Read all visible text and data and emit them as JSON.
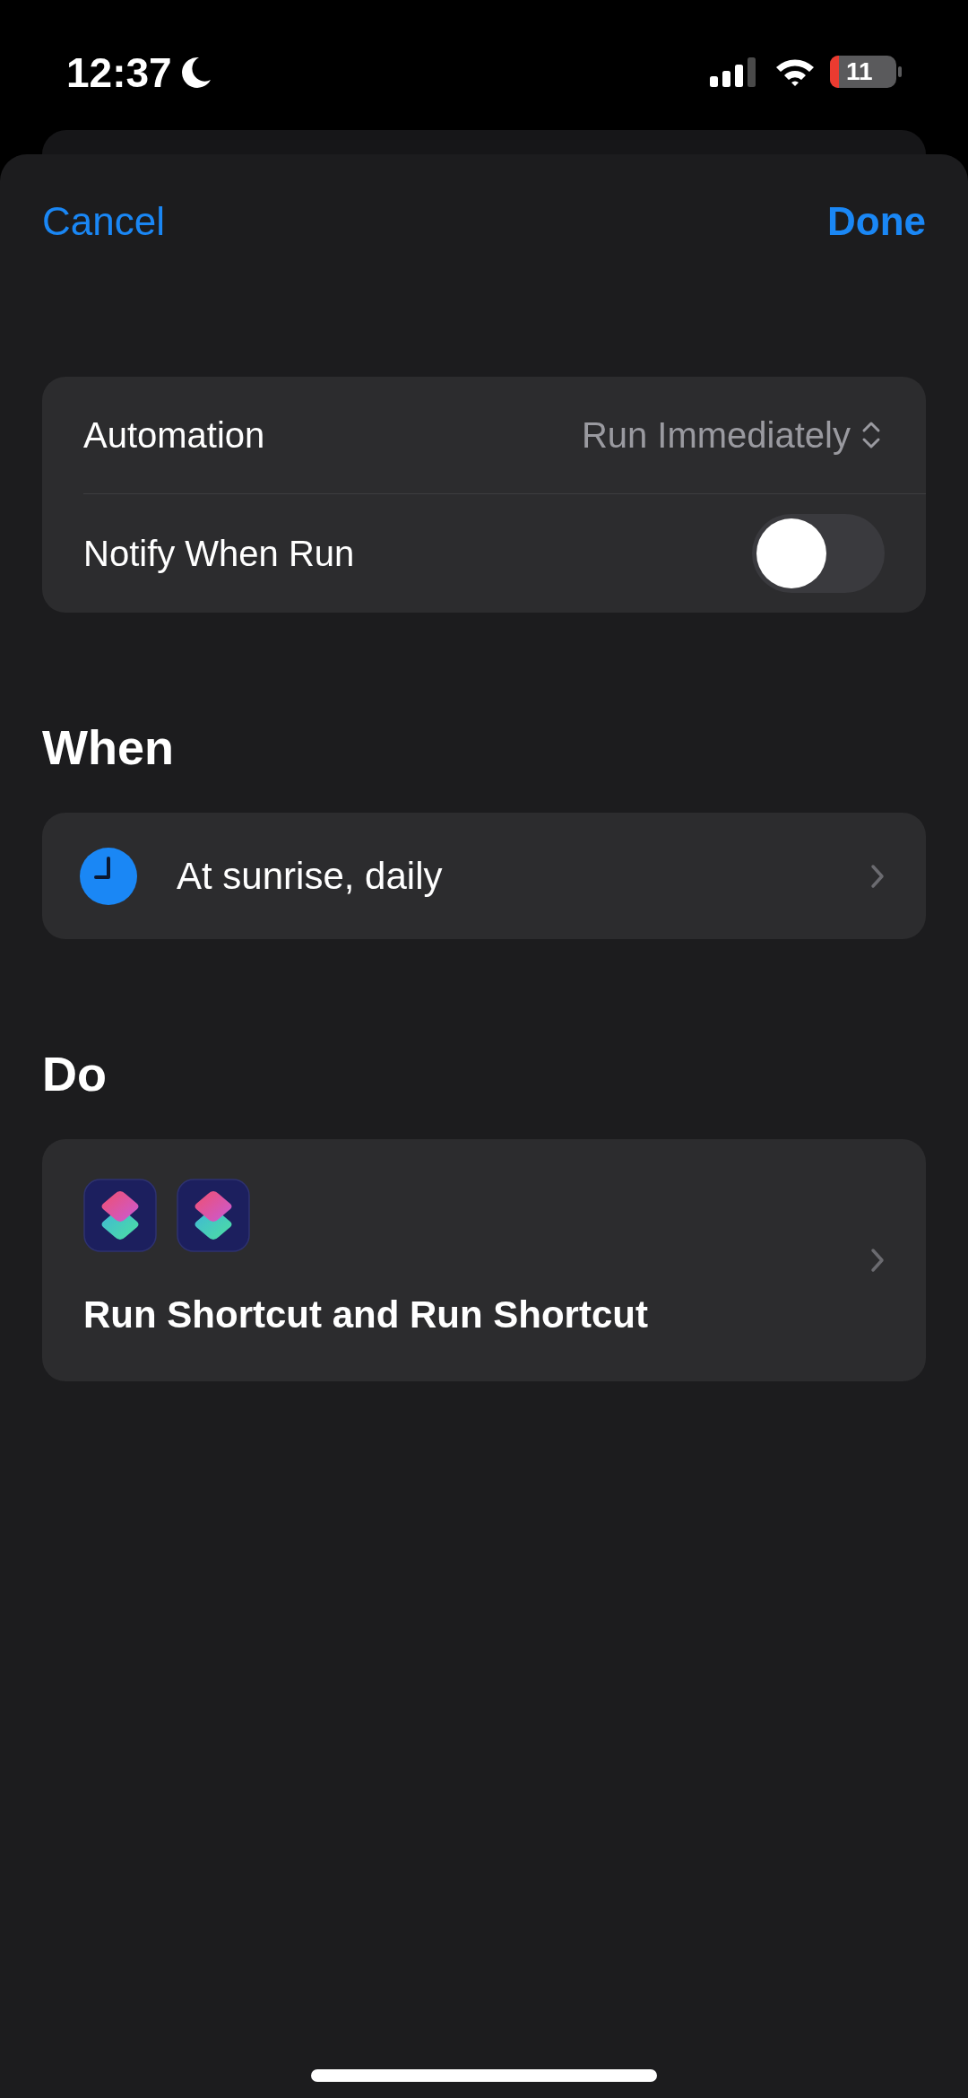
{
  "status_bar": {
    "time": "12:37",
    "battery": "11"
  },
  "nav": {
    "cancel": "Cancel",
    "done": "Done"
  },
  "settings": [
    {
      "kind": "picker",
      "label": "Automation",
      "value": "Run Immediately"
    },
    {
      "kind": "toggle",
      "label": "Notify When Run",
      "on": false
    }
  ],
  "when": {
    "heading": "When",
    "trigger": "At sunrise, daily"
  },
  "do": {
    "heading": "Do",
    "actions": [
      {
        "kind": "shortcut"
      },
      {
        "kind": "shortcut"
      }
    ],
    "summary": "Run Shortcut and Run Shortcut"
  }
}
